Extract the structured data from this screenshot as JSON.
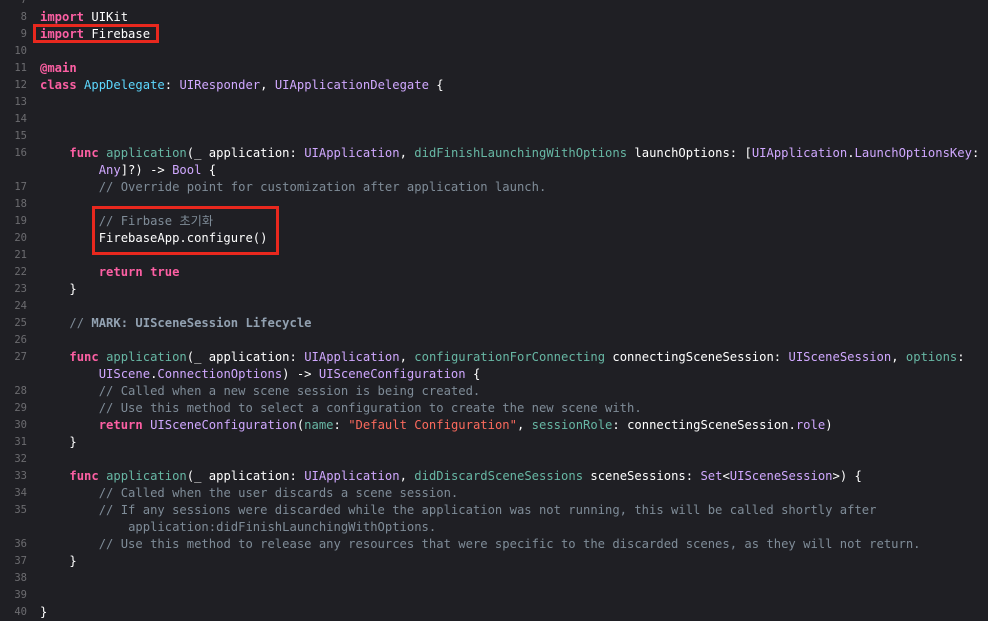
{
  "editor": {
    "lines": [
      {
        "n": "7",
        "t": []
      },
      {
        "n": "8",
        "t": [
          {
            "c": "kw",
            "s": "import"
          },
          {
            "c": "plain",
            "s": " UIKit"
          }
        ]
      },
      {
        "n": "9",
        "t": [
          {
            "c": "kw",
            "s": "import"
          },
          {
            "c": "plain",
            "s": " Firebase"
          }
        ]
      },
      {
        "n": "10",
        "t": []
      },
      {
        "n": "11",
        "t": [
          {
            "c": "kw",
            "s": "@main"
          }
        ]
      },
      {
        "n": "12",
        "t": [
          {
            "c": "kw",
            "s": "class"
          },
          {
            "c": "plain",
            "s": " "
          },
          {
            "c": "proj",
            "s": "AppDelegate"
          },
          {
            "c": "plain",
            "s": ": "
          },
          {
            "c": "type",
            "s": "UIResponder"
          },
          {
            "c": "plain",
            "s": ", "
          },
          {
            "c": "type",
            "s": "UIApplicationDelegate"
          },
          {
            "c": "plain",
            "s": " {"
          }
        ]
      },
      {
        "n": "13",
        "t": []
      },
      {
        "n": "14",
        "t": []
      },
      {
        "n": "15",
        "t": []
      },
      {
        "n": "16",
        "t": [
          {
            "c": "plain",
            "s": "    "
          },
          {
            "c": "kw",
            "s": "func"
          },
          {
            "c": "plain",
            "s": " "
          },
          {
            "c": "fn",
            "s": "application"
          },
          {
            "c": "plain",
            "s": "(_ application: "
          },
          {
            "c": "type",
            "s": "UIApplication"
          },
          {
            "c": "plain",
            "s": ", "
          },
          {
            "c": "fn",
            "s": "didFinishLaunchingWithOptions"
          },
          {
            "c": "plain",
            "s": " launchOptions: ["
          },
          {
            "c": "type",
            "s": "UIApplication"
          },
          {
            "c": "plain",
            "s": "."
          },
          {
            "c": "type",
            "s": "LaunchOptionsKey"
          },
          {
            "c": "plain",
            "s": ":"
          }
        ]
      },
      {
        "n": "",
        "t": [
          {
            "c": "plain",
            "s": "        "
          },
          {
            "c": "type",
            "s": "Any"
          },
          {
            "c": "plain",
            "s": "]?) -> "
          },
          {
            "c": "type",
            "s": "Bool"
          },
          {
            "c": "plain",
            "s": " {"
          }
        ]
      },
      {
        "n": "17",
        "t": [
          {
            "c": "plain",
            "s": "        "
          },
          {
            "c": "cmt",
            "s": "// Override point for customization after application launch."
          }
        ]
      },
      {
        "n": "18",
        "t": []
      },
      {
        "n": "19",
        "t": [
          {
            "c": "plain",
            "s": "        "
          },
          {
            "c": "cmt",
            "s": "// Firbase 초기화"
          }
        ]
      },
      {
        "n": "20",
        "t": [
          {
            "c": "plain",
            "s": "        FirebaseApp.configure()"
          }
        ]
      },
      {
        "n": "21",
        "t": []
      },
      {
        "n": "22",
        "t": [
          {
            "c": "plain",
            "s": "        "
          },
          {
            "c": "kw",
            "s": "return"
          },
          {
            "c": "plain",
            "s": " "
          },
          {
            "c": "kw",
            "s": "true"
          }
        ]
      },
      {
        "n": "23",
        "t": [
          {
            "c": "plain",
            "s": "    }"
          }
        ]
      },
      {
        "n": "24",
        "t": []
      },
      {
        "n": "25",
        "t": [
          {
            "c": "plain",
            "s": "    "
          },
          {
            "c": "cmt",
            "s": "// "
          },
          {
            "c": "mark",
            "s": "MARK: UISceneSession Lifecycle"
          }
        ]
      },
      {
        "n": "26",
        "t": []
      },
      {
        "n": "27",
        "t": [
          {
            "c": "plain",
            "s": "    "
          },
          {
            "c": "kw",
            "s": "func"
          },
          {
            "c": "plain",
            "s": " "
          },
          {
            "c": "fn",
            "s": "application"
          },
          {
            "c": "plain",
            "s": "(_ application: "
          },
          {
            "c": "type",
            "s": "UIApplication"
          },
          {
            "c": "plain",
            "s": ", "
          },
          {
            "c": "fn",
            "s": "configurationForConnecting"
          },
          {
            "c": "plain",
            "s": " connectingSceneSession: "
          },
          {
            "c": "type",
            "s": "UISceneSession"
          },
          {
            "c": "plain",
            "s": ", "
          },
          {
            "c": "fn",
            "s": "options"
          },
          {
            "c": "plain",
            "s": ":"
          }
        ]
      },
      {
        "n": "",
        "t": [
          {
            "c": "plain",
            "s": "        "
          },
          {
            "c": "type",
            "s": "UIScene"
          },
          {
            "c": "plain",
            "s": "."
          },
          {
            "c": "type",
            "s": "ConnectionOptions"
          },
          {
            "c": "plain",
            "s": ") -> "
          },
          {
            "c": "type",
            "s": "UISceneConfiguration"
          },
          {
            "c": "plain",
            "s": " {"
          }
        ]
      },
      {
        "n": "28",
        "t": [
          {
            "c": "plain",
            "s": "        "
          },
          {
            "c": "cmt",
            "s": "// Called when a new scene session is being created."
          }
        ]
      },
      {
        "n": "29",
        "t": [
          {
            "c": "plain",
            "s": "        "
          },
          {
            "c": "cmt",
            "s": "// Use this method to select a configuration to create the new scene with."
          }
        ]
      },
      {
        "n": "30",
        "t": [
          {
            "c": "plain",
            "s": "        "
          },
          {
            "c": "kw",
            "s": "return"
          },
          {
            "c": "plain",
            "s": " "
          },
          {
            "c": "type",
            "s": "UISceneConfiguration"
          },
          {
            "c": "plain",
            "s": "("
          },
          {
            "c": "fn",
            "s": "name"
          },
          {
            "c": "plain",
            "s": ": "
          },
          {
            "c": "str",
            "s": "\"Default Configuration\""
          },
          {
            "c": "plain",
            "s": ", "
          },
          {
            "c": "fn",
            "s": "sessionRole"
          },
          {
            "c": "plain",
            "s": ": connectingSceneSession."
          },
          {
            "c": "type",
            "s": "role"
          },
          {
            "c": "plain",
            "s": ")"
          }
        ]
      },
      {
        "n": "31",
        "t": [
          {
            "c": "plain",
            "s": "    }"
          }
        ]
      },
      {
        "n": "32",
        "t": []
      },
      {
        "n": "33",
        "t": [
          {
            "c": "plain",
            "s": "    "
          },
          {
            "c": "kw",
            "s": "func"
          },
          {
            "c": "plain",
            "s": " "
          },
          {
            "c": "fn",
            "s": "application"
          },
          {
            "c": "plain",
            "s": "(_ application: "
          },
          {
            "c": "type",
            "s": "UIApplication"
          },
          {
            "c": "plain",
            "s": ", "
          },
          {
            "c": "fn",
            "s": "didDiscardSceneSessions"
          },
          {
            "c": "plain",
            "s": " sceneSessions: "
          },
          {
            "c": "type",
            "s": "Set"
          },
          {
            "c": "plain",
            "s": "<"
          },
          {
            "c": "type",
            "s": "UISceneSession"
          },
          {
            "c": "plain",
            "s": ">) {"
          }
        ]
      },
      {
        "n": "34",
        "t": [
          {
            "c": "plain",
            "s": "        "
          },
          {
            "c": "cmt",
            "s": "// Called when the user discards a scene session."
          }
        ]
      },
      {
        "n": "35",
        "t": [
          {
            "c": "plain",
            "s": "        "
          },
          {
            "c": "cmt",
            "s": "// If any sessions were discarded while the application was not running, this will be called shortly after"
          }
        ]
      },
      {
        "n": "",
        "t": [
          {
            "c": "plain",
            "s": "            "
          },
          {
            "c": "cmt",
            "s": "application:didFinishLaunchingWithOptions."
          }
        ]
      },
      {
        "n": "36",
        "t": [
          {
            "c": "plain",
            "s": "        "
          },
          {
            "c": "cmt",
            "s": "// Use this method to release any resources that were specific to the discarded scenes, as they will not return."
          }
        ]
      },
      {
        "n": "37",
        "t": [
          {
            "c": "plain",
            "s": "    }"
          }
        ]
      },
      {
        "n": "38",
        "t": []
      },
      {
        "n": "39",
        "t": []
      },
      {
        "n": "40",
        "t": [
          {
            "c": "plain",
            "s": "}"
          }
        ]
      }
    ]
  },
  "colors": {
    "background": "#1f1f24",
    "keyword": "#fc5fa3",
    "type": "#d0a8ff",
    "function": "#67b7a4",
    "comment": "#7f8c98",
    "string": "#fc6a5d",
    "highlight_box": "#e8281e"
  }
}
